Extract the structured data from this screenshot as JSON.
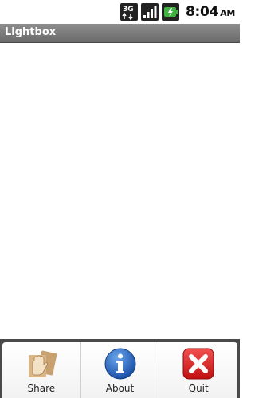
{
  "status_bar": {
    "network_badge": "3G",
    "time": "8:04",
    "ampm": "AM"
  },
  "title_bar": {
    "title": "Lightbox"
  },
  "menu": {
    "items": [
      {
        "label": "Share",
        "icon": "share-hand-icon"
      },
      {
        "label": "About",
        "icon": "info-icon"
      },
      {
        "label": "Quit",
        "icon": "close-x-icon"
      }
    ]
  }
}
